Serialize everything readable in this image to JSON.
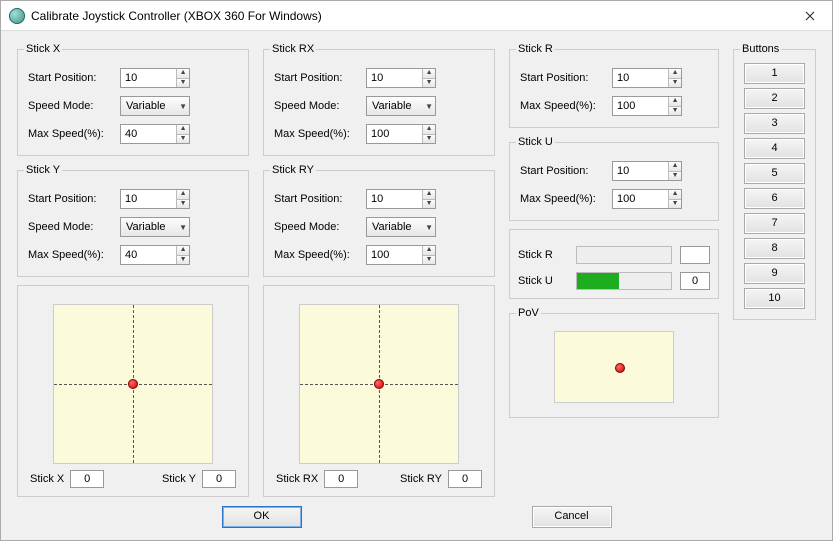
{
  "window": {
    "title": "Calibrate Joystick Controller (XBOX 360 For Windows)"
  },
  "labels": {
    "start_position": "Start Position:",
    "speed_mode": "Speed Mode:",
    "max_speed": "Max Speed(%):"
  },
  "stick_x": {
    "legend": "Stick X",
    "start_position": "10",
    "speed_mode": "Variable",
    "max_speed": "40"
  },
  "stick_y": {
    "legend": "Stick Y",
    "start_position": "10",
    "speed_mode": "Variable",
    "max_speed": "40"
  },
  "stick_rx": {
    "legend": "Stick RX",
    "start_position": "10",
    "speed_mode": "Variable",
    "max_speed": "100"
  },
  "stick_ry": {
    "legend": "Stick RY",
    "start_position": "10",
    "speed_mode": "Variable",
    "max_speed": "100"
  },
  "stick_r": {
    "legend": "Stick R",
    "start_position": "10",
    "max_speed": "100"
  },
  "stick_u": {
    "legend": "Stick U",
    "start_position": "10",
    "max_speed": "100"
  },
  "readouts": {
    "xy": {
      "x_label": "Stick X",
      "x_value": "0",
      "y_label": "Stick Y",
      "y_value": "0"
    },
    "rxy": {
      "x_label": "Stick RX",
      "x_value": "0",
      "y_label": "Stick RY",
      "y_value": "0"
    }
  },
  "bars": {
    "r": {
      "label": "Stick R",
      "value": "",
      "percent": 0
    },
    "u": {
      "label": "Stick U",
      "value": "0",
      "percent": 45
    }
  },
  "pov": {
    "legend": "PoV"
  },
  "buttons_panel": {
    "legend": "Buttons",
    "items": [
      "1",
      "2",
      "3",
      "4",
      "5",
      "6",
      "7",
      "8",
      "9",
      "10"
    ]
  },
  "footer": {
    "ok": "OK",
    "cancel": "Cancel"
  }
}
